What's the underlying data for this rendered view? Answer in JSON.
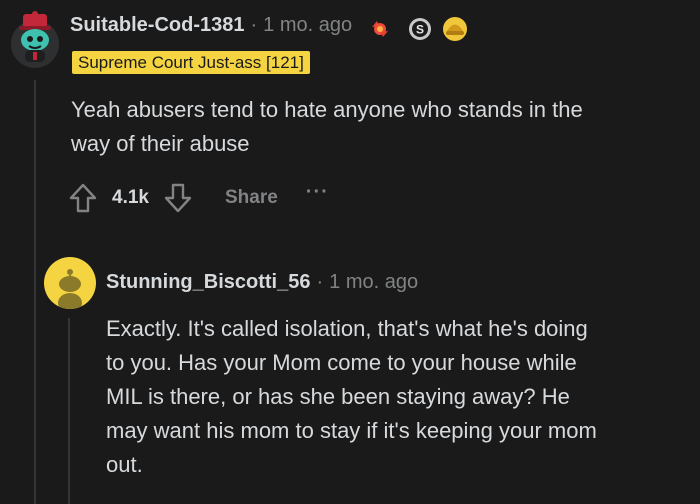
{
  "comment1": {
    "username": "Suitable-Cod-1381",
    "separator": "·",
    "time": "1 mo. ago",
    "flair": "Supreme Court Just-ass [121]",
    "body": "Yeah abusers tend to hate anyone who stands in the way of their abuse",
    "body_line1": "Yeah abusers tend to hate anyone who stands in the",
    "body_line2": "way of their abuse",
    "vote_count": "4.1k",
    "share_label": "Share",
    "more_label": "···",
    "awards": [
      "candy-award-icon",
      "silver-award-icon",
      "helmet-award-icon"
    ]
  },
  "comment2": {
    "username": "Stunning_Biscotti_56",
    "separator": "·",
    "time": "1 mo. ago",
    "body_line1": "Exactly. It's called isolation, that's what he's doing",
    "body_line2": "to you. Has your Mom come to your house while",
    "body_line3": "MIL is there, or has she been staying away? He",
    "body_line4": "may want his mom to stay if it's keeping your mom",
    "body_line5": "out."
  },
  "colors": {
    "background": "#1a1a1b",
    "text": "#d7dadc",
    "meta": "#818384",
    "flair_bg": "#f5d442",
    "avatar2_bg": "#f5d442"
  }
}
